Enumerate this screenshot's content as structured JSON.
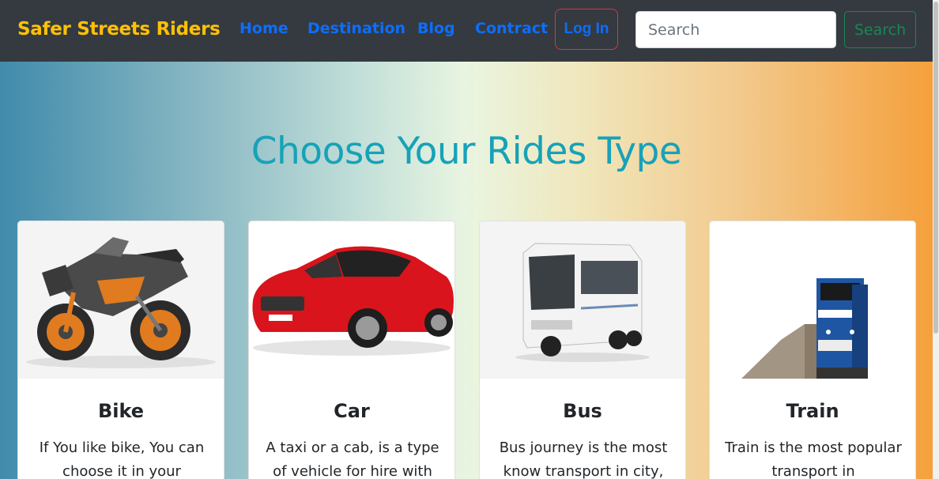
{
  "navbar": {
    "brand": "Safer Streets Riders",
    "links": [
      "Home",
      "Destination",
      "Blog",
      "Contract"
    ],
    "login_label": "Log In",
    "search_placeholder": "Search",
    "search_button": "Search"
  },
  "hero": {
    "title": "Choose Your Rides Type"
  },
  "cards": [
    {
      "title": "Bike",
      "text": "If You like bike, You can choose it in your",
      "image": "motorbike-image"
    },
    {
      "title": "Car",
      "text": "A taxi or a cab, is a type of vehicle for hire with",
      "image": "sports-car-image"
    },
    {
      "title": "Bus",
      "text": "Bus journey is the most know transport in city,",
      "image": "coach-bus-image"
    },
    {
      "title": "Train",
      "text": "Train is the most popular transport in",
      "image": "locomotive-train-image"
    }
  ],
  "colors": {
    "navbar_bg": "#343a40",
    "brand": "#ffc107",
    "link": "#0d6efd",
    "login_border": "#dc3545",
    "search_button": "#198754",
    "hero_title": "#17a2b8"
  }
}
